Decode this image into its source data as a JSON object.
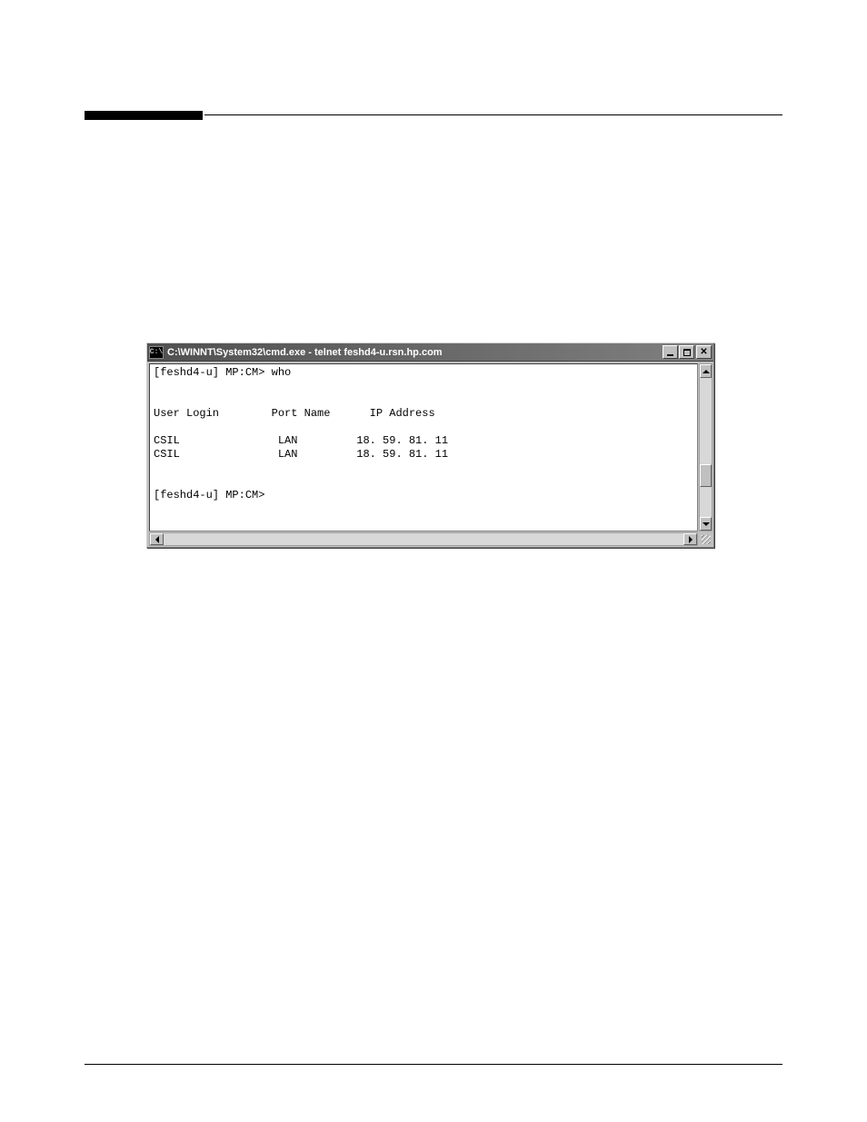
{
  "window": {
    "icon_text": "C:\\",
    "title": "C:\\WINNT\\System32\\cmd.exe - telnet feshd4-u.rsn.hp.com"
  },
  "terminal": {
    "line1": "[feshd4-u] MP:CM> who",
    "line2": "",
    "line3": "",
    "line4": "User Login        Port Name      IP Address",
    "line5": "",
    "line6": "CSIL               LAN         18. 59. 81. 11",
    "line7": "CSIL               LAN         18. 59. 81. 11",
    "line8": "",
    "line9": "",
    "line10": "[feshd4-u] MP:CM>"
  }
}
